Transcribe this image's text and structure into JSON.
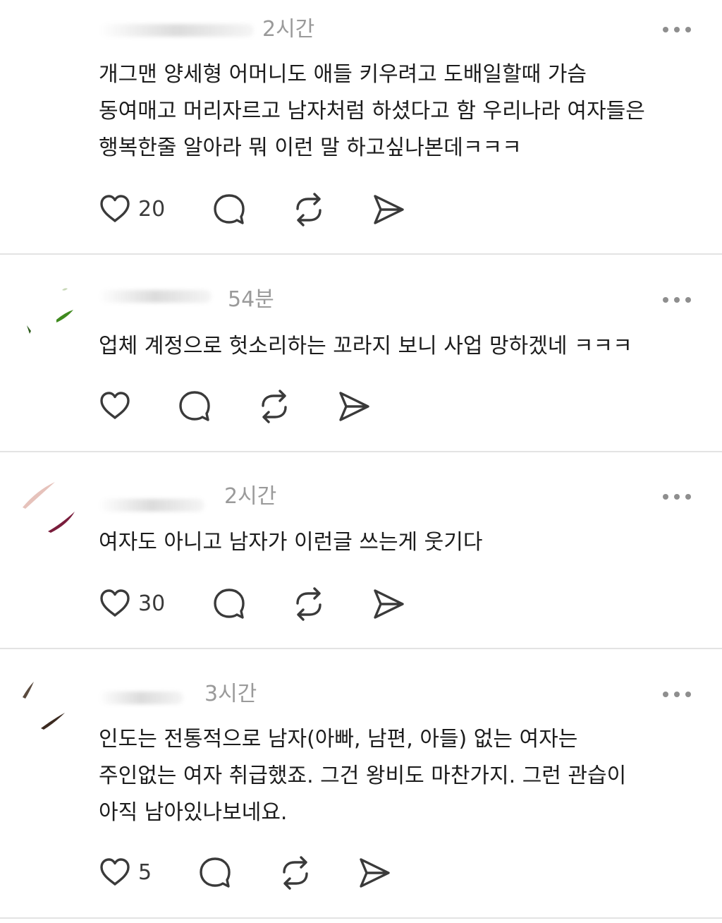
{
  "posts": [
    {
      "time": "2시간",
      "lines": [
        "개그맨 양세형 어머니도 애들 키우려고 도배일할때 가슴",
        "동여매고 머리자르고 남자처럼 하셨다고 함 우리나라 여자들은",
        "행복한줄 알아라 뭐 이런 말 하고싶나본데ㅋㅋㅋ"
      ],
      "likes": "20"
    },
    {
      "time": "54분",
      "lines": [
        "업체 계정으로 헛소리하는 꼬라지 보니 사업 망하겠네 ㅋㅋㅋ"
      ],
      "likes": ""
    },
    {
      "time": "2시간",
      "lines": [
        "여자도 아니고 남자가 이런글 쓰는게 웃기다"
      ],
      "likes": "30"
    },
    {
      "time": "3시간",
      "lines": [
        "인도는 전통적으로 남자(아빠, 남편, 아들) 없는 여자는",
        "주인없는 여자 취급했죠. 그건 왕비도 마찬가지. 그런 관습이",
        "아직 남아있나보네요."
      ],
      "likes": "5"
    }
  ],
  "icons": {
    "like": "heart-icon",
    "comment": "comment-bubble-icon",
    "repost": "repost-icon",
    "share": "send-icon",
    "more": "more-options-icon"
  },
  "colors": {
    "text": "#1c1c1c",
    "muted": "#9a9a9a",
    "icon": "#3a3a3a",
    "divider": "#e3e3e3"
  }
}
